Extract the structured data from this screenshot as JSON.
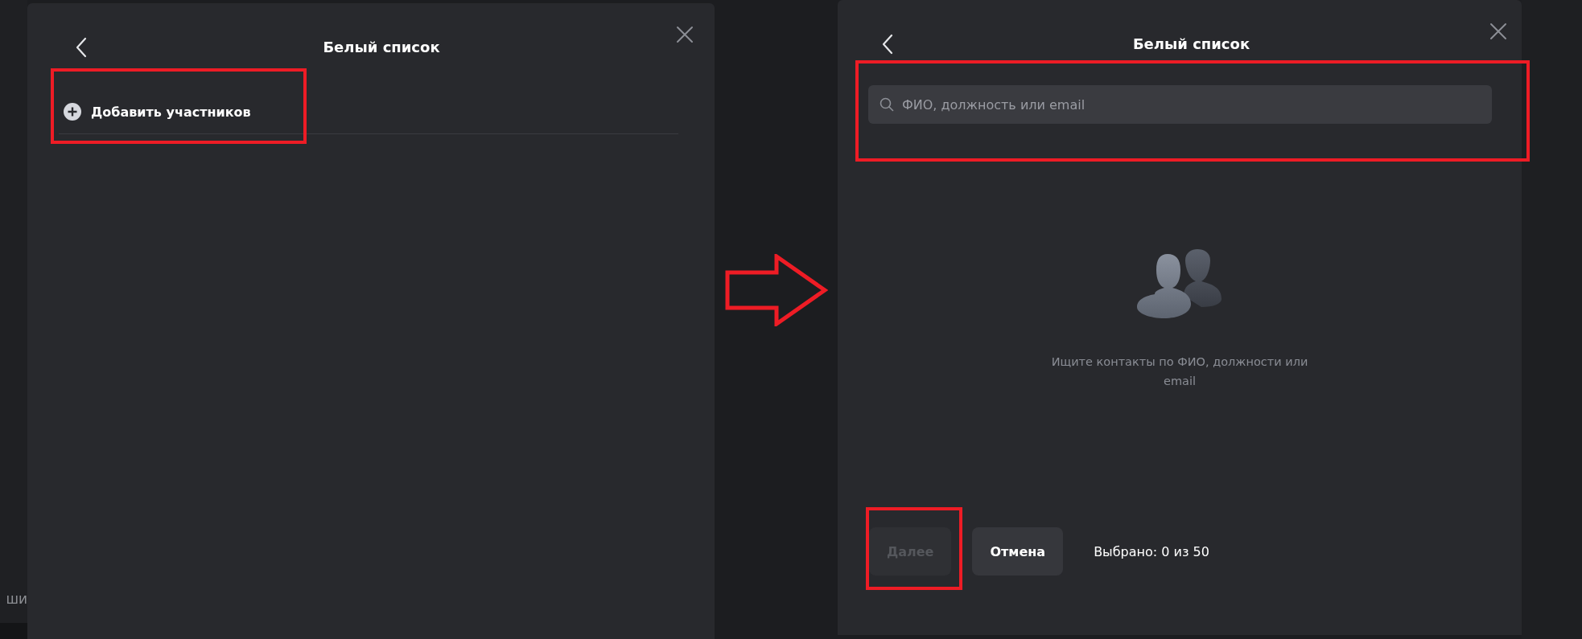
{
  "background_text": "ши",
  "left_dialog": {
    "title": "Белый список",
    "add_participants": "Добавить участников"
  },
  "right_dialog": {
    "title": "Белый список",
    "search": {
      "placeholder": "ФИО, должность или email"
    },
    "empty_state": "Ищите контакты по ФИО, должности или email",
    "buttons": [
      {
        "label": "Далее",
        "disabled": true
      },
      {
        "label": "Отмена",
        "disabled": false
      }
    ],
    "selected_count": "Выбрано: 0 из 50"
  }
}
